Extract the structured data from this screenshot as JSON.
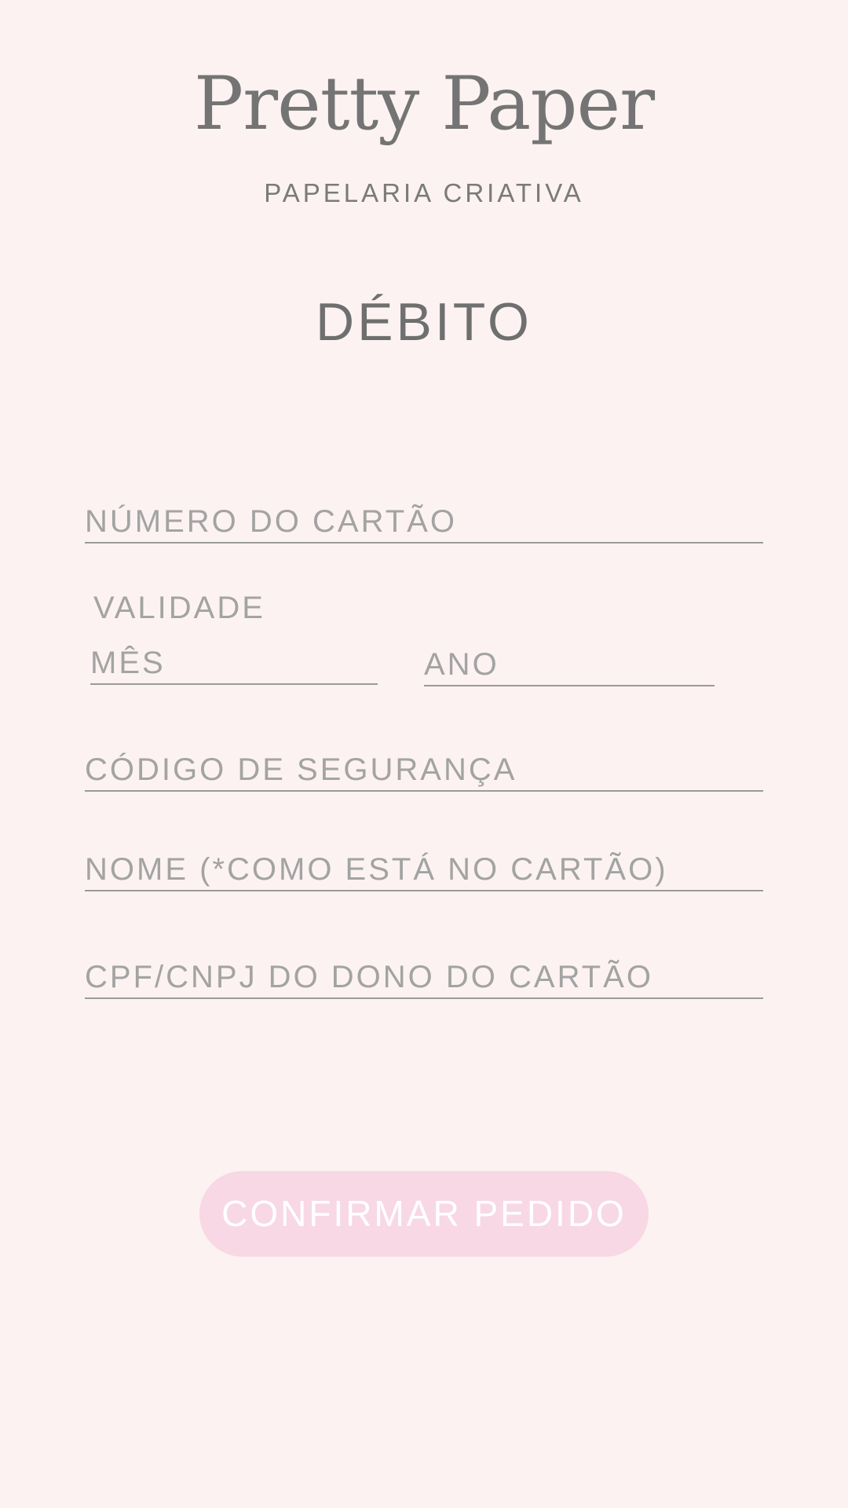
{
  "brand": {
    "name": "Pretty Paper",
    "tagline": "PAPELARIA CRIATIVA"
  },
  "page": {
    "title": "DÉBITO"
  },
  "form": {
    "card_number_placeholder": "NÚMERO DO CARTÃO",
    "validity_label": "VALIDADE",
    "month_placeholder": "MÊS",
    "year_placeholder": "ANO",
    "security_code_placeholder": "CÓDIGO DE SEGURANÇA",
    "name_placeholder": "NOME (*COMO ESTÁ NO CARTÃO)",
    "document_placeholder": "CPF/CNPJ DO DONO DO CARTÃO"
  },
  "actions": {
    "confirm_label": "CONFIRMAR PEDIDO"
  },
  "colors": {
    "background": "#fdf2f2",
    "text_dark": "#747474",
    "placeholder": "#a3a3a3",
    "button_bg": "#f7d8e4",
    "button_text": "#ffffff"
  }
}
